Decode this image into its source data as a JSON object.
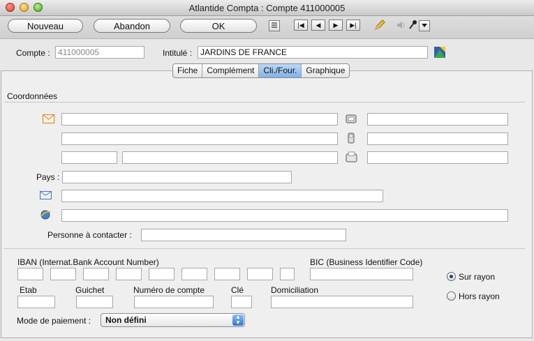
{
  "window": {
    "title": "Atlantide Compta : Compte 411000005"
  },
  "toolbar": {
    "nouveau_label": "Nouveau",
    "abandon_label": "Abandon",
    "ok_label": "OK",
    "nav_first": "|◀",
    "nav_prev": "◀",
    "nav_next": "▶",
    "nav_last": "▶|"
  },
  "header": {
    "compte_label": "Compte :",
    "compte_value": "411000005",
    "intitule_label": "Intitulé :",
    "intitule_value": "JARDINS DE FRANCE"
  },
  "tabs": [
    {
      "label": "Fiche"
    },
    {
      "label": "Complément"
    },
    {
      "label": "Cli./Four."
    },
    {
      "label": "Graphique"
    }
  ],
  "coordonnees": {
    "section_title": "Coordonnées",
    "pays_label": "Pays :",
    "contact_label": "Personne à contacter :"
  },
  "bank": {
    "iban_label": "IBAN (Internat.Bank Account Number)",
    "bic_label": "BIC (Business Identifier Code)",
    "etab_label": "Etab",
    "guichet_label": "Guichet",
    "numero_label": "Numéro de compte",
    "cle_label": "Clé",
    "domiciliation_label": "Domiciliation"
  },
  "rayon": {
    "sur_label": "Sur rayon",
    "hors_label": "Hors rayon",
    "selected": "sur"
  },
  "paiement": {
    "label": "Mode de paiement :",
    "value": "Non défini"
  },
  "colors": {
    "accent": "#7fb2ea",
    "envelope": "#e07a1a"
  },
  "icons": [
    "envelope-icon",
    "phone-icon",
    "mobile-icon",
    "fax-icon",
    "mail-icon",
    "internet-icon",
    "pencil-icon",
    "speaker-icon",
    "mic-icon",
    "list-icon",
    "logo-icon"
  ]
}
